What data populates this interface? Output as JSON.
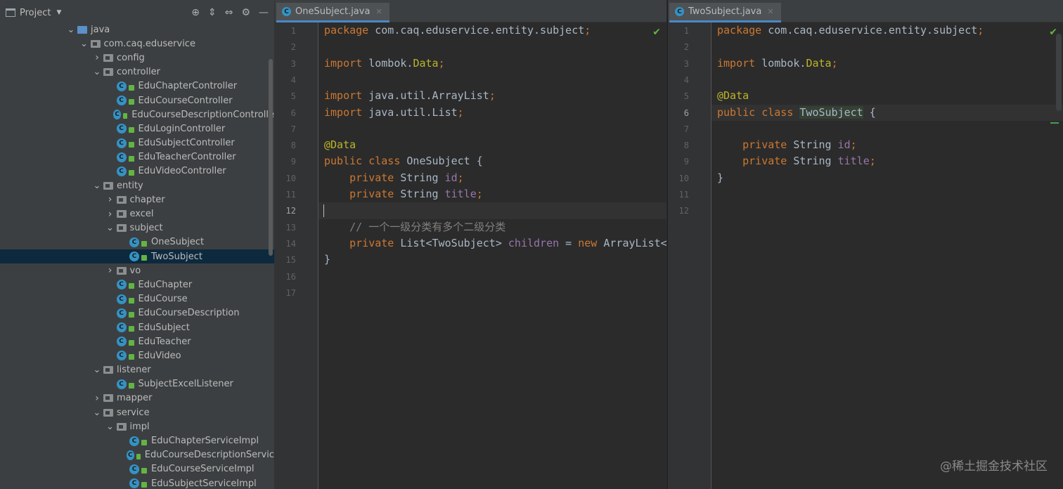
{
  "project_panel": {
    "title": "Project",
    "tree": [
      {
        "label": "java",
        "indent": 0,
        "arrow": "down",
        "kind": "srcfolder"
      },
      {
        "label": "com.caq.eduservice",
        "indent": 1,
        "arrow": "down",
        "kind": "folder"
      },
      {
        "label": "config",
        "indent": 2,
        "arrow": "right",
        "kind": "folder"
      },
      {
        "label": "controller",
        "indent": 2,
        "arrow": "down",
        "kind": "folder"
      },
      {
        "label": "EduChapterController",
        "indent": 3,
        "kind": "class"
      },
      {
        "label": "EduCourseController",
        "indent": 3,
        "kind": "class"
      },
      {
        "label": "EduCourseDescriptionControlle",
        "indent": 3,
        "kind": "class"
      },
      {
        "label": "EduLoginController",
        "indent": 3,
        "kind": "class"
      },
      {
        "label": "EduSubjectController",
        "indent": 3,
        "kind": "class"
      },
      {
        "label": "EduTeacherController",
        "indent": 3,
        "kind": "class"
      },
      {
        "label": "EduVideoController",
        "indent": 3,
        "kind": "class"
      },
      {
        "label": "entity",
        "indent": 2,
        "arrow": "down",
        "kind": "folder"
      },
      {
        "label": "chapter",
        "indent": 3,
        "arrow": "right",
        "kind": "folder"
      },
      {
        "label": "excel",
        "indent": 3,
        "arrow": "right",
        "kind": "folder"
      },
      {
        "label": "subject",
        "indent": 3,
        "arrow": "down",
        "kind": "folder"
      },
      {
        "label": "OneSubject",
        "indent": 4,
        "kind": "class"
      },
      {
        "label": "TwoSubject",
        "indent": 4,
        "kind": "class",
        "selected": true
      },
      {
        "label": "vo",
        "indent": 3,
        "arrow": "right",
        "kind": "folder"
      },
      {
        "label": "EduChapter",
        "indent": 3,
        "kind": "class"
      },
      {
        "label": "EduCourse",
        "indent": 3,
        "kind": "class"
      },
      {
        "label": "EduCourseDescription",
        "indent": 3,
        "kind": "class"
      },
      {
        "label": "EduSubject",
        "indent": 3,
        "kind": "class"
      },
      {
        "label": "EduTeacher",
        "indent": 3,
        "kind": "class"
      },
      {
        "label": "EduVideo",
        "indent": 3,
        "kind": "class"
      },
      {
        "label": "listener",
        "indent": 2,
        "arrow": "down",
        "kind": "folder"
      },
      {
        "label": "SubjectExcelListener",
        "indent": 3,
        "kind": "class"
      },
      {
        "label": "mapper",
        "indent": 2,
        "arrow": "right",
        "kind": "folder"
      },
      {
        "label": "service",
        "indent": 2,
        "arrow": "down",
        "kind": "folder"
      },
      {
        "label": "impl",
        "indent": 3,
        "arrow": "down",
        "kind": "folder"
      },
      {
        "label": "EduChapterServiceImpl",
        "indent": 4,
        "kind": "class"
      },
      {
        "label": "EduCourseDescriptionServic",
        "indent": 4,
        "kind": "class"
      },
      {
        "label": "EduCourseServiceImpl",
        "indent": 4,
        "kind": "class"
      },
      {
        "label": "EduSubjectServiceImpl",
        "indent": 4,
        "kind": "class"
      }
    ]
  },
  "editors": [
    {
      "tab_label": "OneSubject.java",
      "current_line": 12,
      "lines": [
        [
          [
            "kw",
            "package "
          ],
          [
            "t",
            "com.caq.eduservice.entity.subject"
          ],
          [
            "kw",
            ";"
          ]
        ],
        [],
        [
          [
            "kw",
            "import "
          ],
          [
            "t",
            "lombok."
          ],
          [
            "ann",
            "Data"
          ],
          [
            "kw",
            ";"
          ]
        ],
        [],
        [
          [
            "kw",
            "import "
          ],
          [
            "t",
            "java.util.ArrayList"
          ],
          [
            "kw",
            ";"
          ]
        ],
        [
          [
            "kw",
            "import "
          ],
          [
            "t",
            "java.util.List"
          ],
          [
            "kw",
            ";"
          ]
        ],
        [],
        [
          [
            "ann",
            "@Data"
          ]
        ],
        [
          [
            "kw",
            "public class "
          ],
          [
            "t",
            "OneSubject {"
          ]
        ],
        [
          [
            "t",
            "    "
          ],
          [
            "kw",
            "private "
          ],
          [
            "t",
            "String "
          ],
          [
            "fld",
            "id"
          ],
          [
            "kw",
            ";"
          ]
        ],
        [
          [
            "t",
            "    "
          ],
          [
            "kw",
            "private "
          ],
          [
            "t",
            "String "
          ],
          [
            "fld",
            "title"
          ],
          [
            "kw",
            ";"
          ]
        ],
        [],
        [
          [
            "cm",
            "    // 一个一级分类有多个二级分类"
          ]
        ],
        [
          [
            "t",
            "    "
          ],
          [
            "kw",
            "private "
          ],
          [
            "t",
            "List<TwoSubject> "
          ],
          [
            "fld",
            "children"
          ],
          [
            "t",
            " = "
          ],
          [
            "kw",
            "new "
          ],
          [
            "t",
            "ArrayList<>"
          ]
        ],
        [
          [
            "t",
            "}"
          ]
        ],
        [],
        []
      ]
    },
    {
      "tab_label": "TwoSubject.java",
      "current_line": 6,
      "lines": [
        [
          [
            "kw",
            "package "
          ],
          [
            "t",
            "com.caq.eduservice.entity.subject"
          ],
          [
            "kw",
            ";"
          ]
        ],
        [],
        [
          [
            "kw",
            "import "
          ],
          [
            "t",
            "lombok."
          ],
          [
            "ann",
            "Data"
          ],
          [
            "kw",
            ";"
          ]
        ],
        [],
        [
          [
            "ann",
            "@Data"
          ]
        ],
        [
          [
            "kw",
            "public class "
          ],
          [
            "hl",
            "TwoSubject"
          ],
          [
            "t",
            " {"
          ]
        ],
        [],
        [
          [
            "t",
            "    "
          ],
          [
            "kw",
            "private "
          ],
          [
            "t",
            "String "
          ],
          [
            "fld",
            "id"
          ],
          [
            "kw",
            ";"
          ]
        ],
        [
          [
            "t",
            "    "
          ],
          [
            "kw",
            "private "
          ],
          [
            "t",
            "String "
          ],
          [
            "fld",
            "title"
          ],
          [
            "kw",
            ";"
          ]
        ],
        [
          [
            "t",
            "}"
          ]
        ],
        [],
        []
      ]
    }
  ],
  "watermark": "@稀土掘金技术社区",
  "icons": {
    "project": "project-icon",
    "locate": "locate-icon",
    "expand": "expand-all-icon",
    "collapse": "collapse-all-icon",
    "settings": "gear-icon",
    "hide": "minimize-icon",
    "class": "class-icon",
    "check": "check-icon"
  },
  "colors": {
    "keyword": "#cc7832",
    "annotation": "#bbb529",
    "field": "#9876aa",
    "comment": "#808080",
    "selection": "#0d293e"
  }
}
